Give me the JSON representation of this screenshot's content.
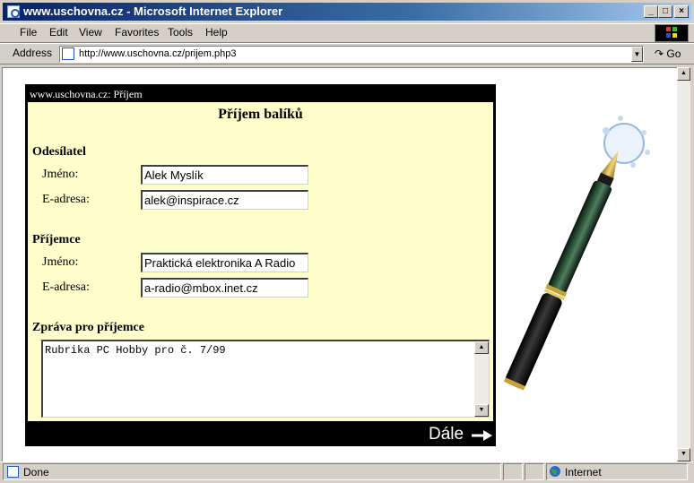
{
  "window": {
    "title": "www.uschovna.cz - Microsoft Internet Explorer",
    "controls": {
      "minimize": "_",
      "maximize": "□",
      "close": "×"
    }
  },
  "menu": {
    "items": [
      {
        "label": "File"
      },
      {
        "label": "Edit"
      },
      {
        "label": "View"
      },
      {
        "label": "Favorites"
      },
      {
        "label": "Tools"
      },
      {
        "label": "Help"
      }
    ]
  },
  "address_bar": {
    "label": "Address",
    "url": "http://www.uschovna.cz/prijem.php3",
    "go_label": "Go"
  },
  "page": {
    "panel_header": "www.uschovna.cz: Příjem",
    "title": "Příjem balíků",
    "sender": {
      "heading": "Odesílatel",
      "name_label": "Jméno:",
      "name_value": "Alek Myslík",
      "email_label": "E-adresa:",
      "email_value": "alek@inspirace.cz"
    },
    "recipient": {
      "heading": "Příjemce",
      "name_label": "Jméno:",
      "name_value": "Praktická elektronika A Radio",
      "email_label": "E-adresa:",
      "email_value": "a-radio@mbox.inet.cz"
    },
    "message": {
      "heading": "Zpráva pro příjemce",
      "value": "Rubrika PC Hobby pro č. 7/99"
    },
    "next_label": "Dále"
  },
  "status_bar": {
    "status": "Done",
    "zone": "Internet"
  },
  "colors": {
    "form_background": "#ffffcc",
    "panel_frame": "#000000",
    "title_bar_start": "#0a246a",
    "title_bar_end": "#a6caf0"
  }
}
